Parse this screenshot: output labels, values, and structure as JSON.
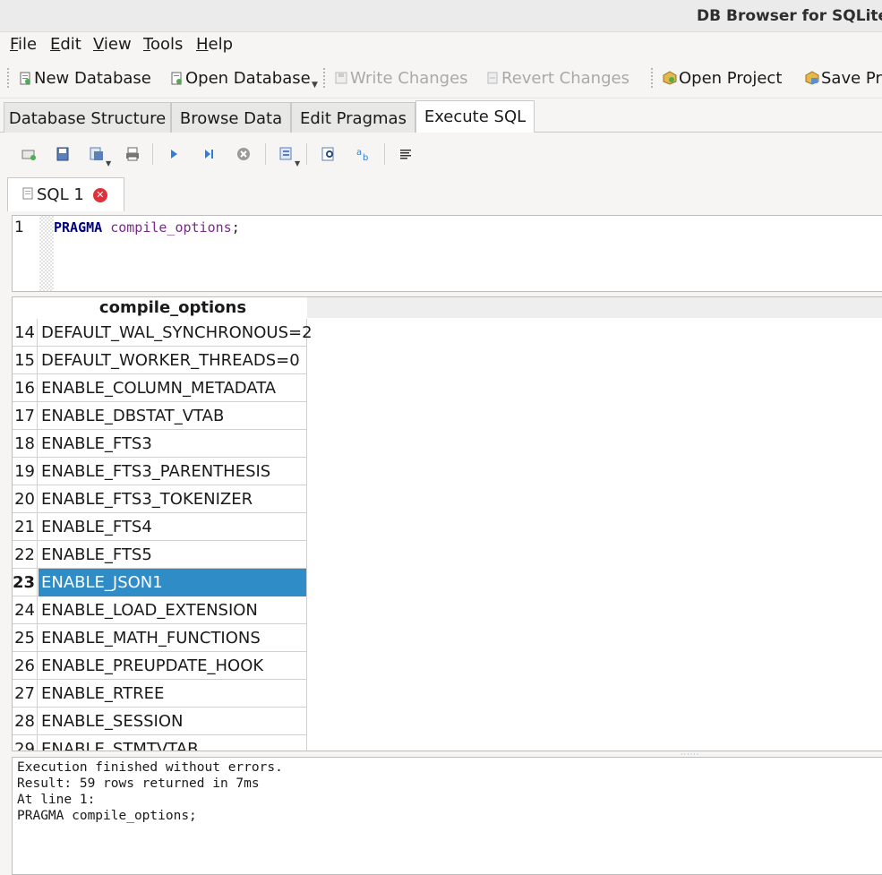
{
  "window": {
    "title": "DB Browser for SQLite -"
  },
  "menu": [
    {
      "label": "File"
    },
    {
      "label": "Edit"
    },
    {
      "label": "View"
    },
    {
      "label": "Tools"
    },
    {
      "label": "Help"
    }
  ],
  "toolbar": {
    "new_db": "New Database",
    "open_db": "Open Database",
    "write_changes": "Write Changes",
    "revert_changes": "Revert Changes",
    "open_project": "Open Project",
    "save_project": "Save Pro"
  },
  "tabs": {
    "structure": "Database Structure",
    "browse": "Browse Data",
    "pragmas": "Edit Pragmas",
    "execute": "Execute SQL"
  },
  "editor_toolbar_icons": [
    "open-tab-icon",
    "open-sql-file-icon",
    "save-sql-file-icon",
    "print-icon",
    "execute-all-icon",
    "execute-current-line-icon",
    "stop-execution-icon",
    "save-results-icon",
    "find-icon",
    "find-replace-icon",
    "comment-icon"
  ],
  "sql_tab": {
    "label": "SQL 1"
  },
  "editor": {
    "line_number": "1",
    "keyword": "PRAGMA",
    "function": "compile_options",
    "terminator": ";"
  },
  "results": {
    "column_header": "compile_options",
    "rows": [
      {
        "n": "14",
        "v": "DEFAULT_WAL_SYNCHRONOUS=2"
      },
      {
        "n": "15",
        "v": "DEFAULT_WORKER_THREADS=0"
      },
      {
        "n": "16",
        "v": "ENABLE_COLUMN_METADATA"
      },
      {
        "n": "17",
        "v": "ENABLE_DBSTAT_VTAB"
      },
      {
        "n": "18",
        "v": "ENABLE_FTS3"
      },
      {
        "n": "19",
        "v": "ENABLE_FTS3_PARENTHESIS"
      },
      {
        "n": "20",
        "v": "ENABLE_FTS3_TOKENIZER"
      },
      {
        "n": "21",
        "v": "ENABLE_FTS4"
      },
      {
        "n": "22",
        "v": "ENABLE_FTS5"
      },
      {
        "n": "23",
        "v": "ENABLE_JSON1"
      },
      {
        "n": "24",
        "v": "ENABLE_LOAD_EXTENSION"
      },
      {
        "n": "25",
        "v": "ENABLE_MATH_FUNCTIONS"
      },
      {
        "n": "26",
        "v": "ENABLE_PREUPDATE_HOOK"
      },
      {
        "n": "27",
        "v": "ENABLE_RTREE"
      },
      {
        "n": "28",
        "v": "ENABLE_SESSION"
      },
      {
        "n": "29",
        "v": "ENABLE_STMTVTAB"
      }
    ],
    "selected_row": "23"
  },
  "log": {
    "line1": "Execution finished without errors.",
    "line2": "Result: 59 rows returned in 7ms",
    "line3": "At line 1:",
    "line4": "PRAGMA compile_options;"
  },
  "colors": {
    "selection": "#308cc6",
    "keyword": "#00007f",
    "function": "#7a2a8c",
    "close_badge": "#e0313a"
  }
}
